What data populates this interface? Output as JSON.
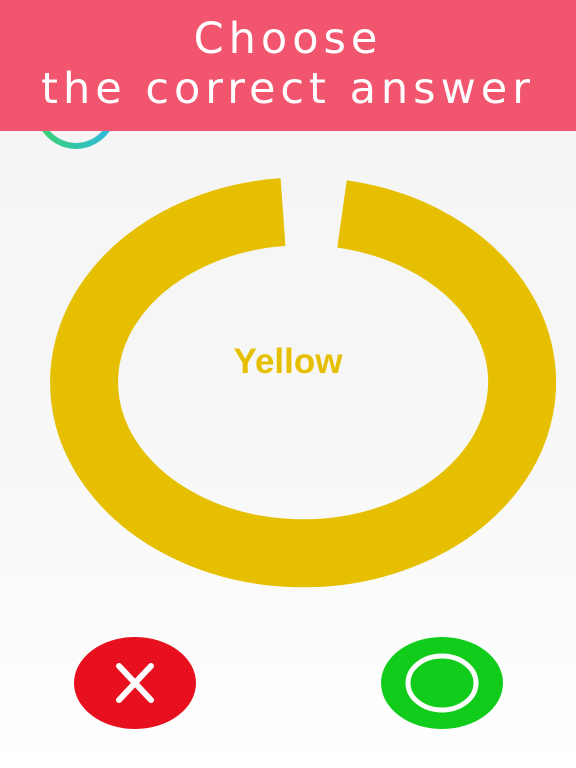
{
  "header": {
    "title_line1": "Choose",
    "title_line2": "the correct answer",
    "background_color": "#f2566f",
    "text_color": "#ffffff"
  },
  "timer": {
    "icon": "timer-ring-icon",
    "colors": [
      "#2fb7e8",
      "#3ad46a"
    ]
  },
  "question": {
    "word": "Yellow",
    "word_color": "#e6c000",
    "ring_color": "#e6c000"
  },
  "answers": {
    "wrong": {
      "icon": "cross-icon",
      "color": "#e8101e"
    },
    "correct": {
      "icon": "circle-icon",
      "color": "#12cc1c"
    }
  }
}
